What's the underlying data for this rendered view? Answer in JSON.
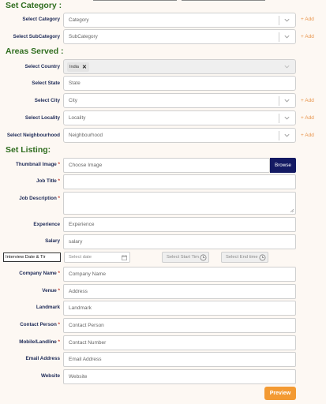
{
  "sections": {
    "category": "Set Category :",
    "areas": "Areas Served :",
    "listing": "Set Listing:"
  },
  "category": {
    "select_category_label": "Select Category",
    "category_placeholder": "Category",
    "select_subcategory_label": "Select SubCategory",
    "subcategory_placeholder": "SubCategory",
    "add_label": "+ Add"
  },
  "areas": {
    "country_label": "Select Country",
    "country_chip": "India",
    "state_label": "Select State",
    "state_placeholder": "State",
    "city_label": "Select City",
    "city_placeholder": "City",
    "locality_label": "Select Locality",
    "locality_placeholder": "Locality",
    "neighbourhood_label": "Select Neighbourhood",
    "neighbourhood_placeholder": "Neighbourhood",
    "add_label": "+ Add"
  },
  "listing": {
    "thumbnail_label": "Thumbnail Image",
    "thumbnail_placeholder": "Choose Image",
    "browse": "Browse",
    "job_title_label": "Job Title",
    "job_description_label": "Job Description",
    "experience_label": "Experience",
    "experience_placeholder": "Experience",
    "salary_label": "Salary",
    "salary_placeholder": "salary",
    "interview_select": "Interview Date & Tir",
    "select_date_placeholder": "Select date",
    "start_time_placeholder": "Select Start Tim",
    "end_time_placeholder": "Select End time",
    "company_name_label": "Company Name",
    "company_name_placeholder": "Company Name",
    "venue_label": "Venue",
    "venue_placeholder": "Address",
    "landmark_label": "Landmark",
    "landmark_placeholder": "Landmark",
    "contact_person_label": "Contact Person",
    "contact_person_placeholder": "Contact Person",
    "mobile_label": "Mobile/Landline",
    "mobile_placeholder": "Contact Number",
    "email_label": "Email Address",
    "email_placeholder": "Email Address",
    "website_label": "Website",
    "website_placeholder": "Website",
    "preview": "Preview",
    "required_mark": "*"
  },
  "colors": {
    "section_title": "#2f6d1f",
    "label": "#1d2a57",
    "add_link": "#e8954c",
    "browse_bg": "#141a63",
    "preview_bg": "#f39a33"
  }
}
